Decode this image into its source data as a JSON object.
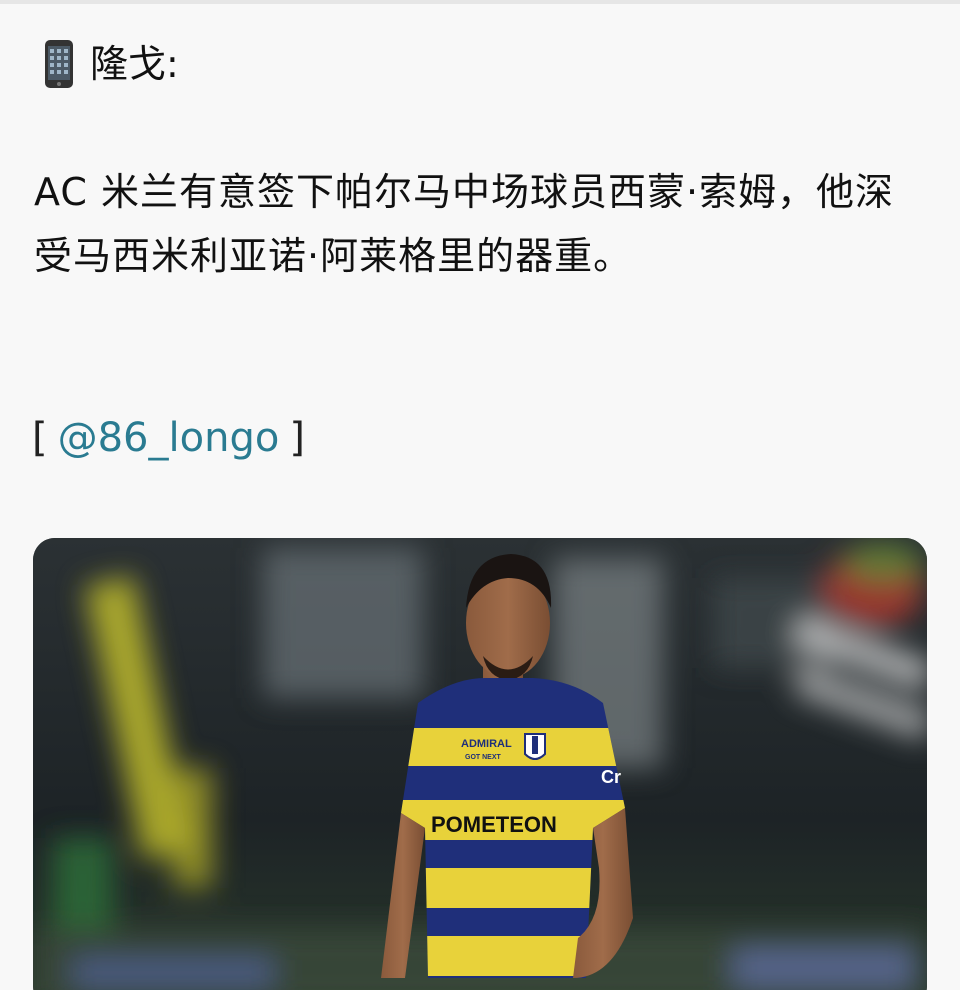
{
  "post": {
    "author_name": "隆戈:",
    "author_icon": "mobile-phone-icon",
    "text": "AC 米兰有意签下帕尔马中场球员西蒙·索姆，他深受马西米利亚诺·阿莱格里的器重。",
    "source_open": "[",
    "source_handle": "@86_longo",
    "source_close": "]",
    "link_color": "#2a7b91"
  },
  "photo": {
    "jersey_sponsor_top": "ADMIRAL",
    "jersey_sponsor_sub": "GOT NEXT",
    "jersey_sponsor_main": "POMETEON",
    "jersey_colors": [
      "#1f2f7a",
      "#e8d23a"
    ]
  }
}
